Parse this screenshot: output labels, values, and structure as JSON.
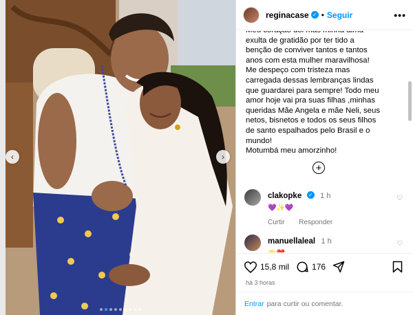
{
  "colors": {
    "accent": "#0095f6",
    "muted": "#737373",
    "dot_active": "#3897f0"
  },
  "header": {
    "username": "reginacase",
    "verified_icon": "verified-badge-icon",
    "separator": "•",
    "follow_label": "Seguir",
    "more_label": "•••"
  },
  "post": {
    "caption": "Meu coração dói mas minha alma\nexulta de gratidão por ter tido a\nbenção de conviver tantos e tantos\nanos com esta mulher maravilhosa!\nMe despeço com tristeza mas\ncarregada dessas lembranças lindas\nque guardarei para sempre! Todo meu\namor hoje vai  pra suas filhas ,minhas\nqueridas Mãe Angela e mãe Neli, seus\nnetos, bisnetos e todos os seus filhos\nde santo espalhados pelo Brasil e o\nmundo!\nMotumbá meu amorzinho!",
    "load_more_icon": "plus-circle-icon",
    "likes": "15,8 mil",
    "comments": "176",
    "time_ago": "há 3 horas"
  },
  "comments": [
    {
      "user": "clakopke",
      "verified": true,
      "time": "1 h",
      "text": "💜✨💜",
      "reply_label": "Responder",
      "like_label": "Curtir"
    },
    {
      "user": "manuellaleal",
      "verified": false,
      "time": "1 h",
      "text": "🌟❤️",
      "reply_label": "",
      "like_label": ""
    }
  ],
  "footer": {
    "login_label": "Entrar",
    "prompt": "para curtir ou comentar."
  },
  "carousel": {
    "total_slides": 9,
    "active_slide": 1
  }
}
